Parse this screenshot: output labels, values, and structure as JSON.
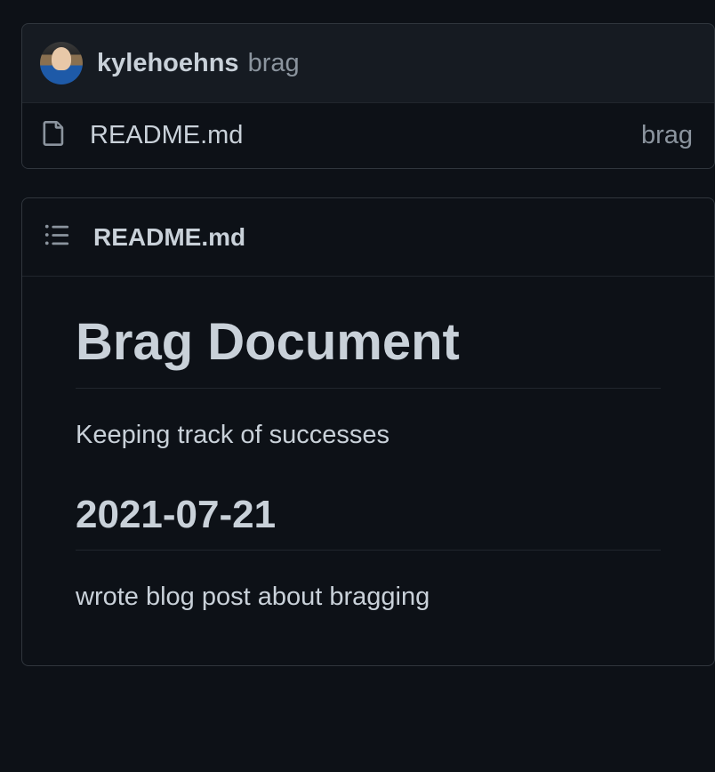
{
  "commit": {
    "author": "kylehoehns",
    "message": "brag"
  },
  "file_row": {
    "filename": "README.md",
    "commit_message": "brag"
  },
  "readme": {
    "header_title": "README.md",
    "content": {
      "h1": "Brag Document",
      "intro": "Keeping track of successes",
      "h2": "2021-07-21",
      "body": "wrote blog post about bragging"
    }
  }
}
